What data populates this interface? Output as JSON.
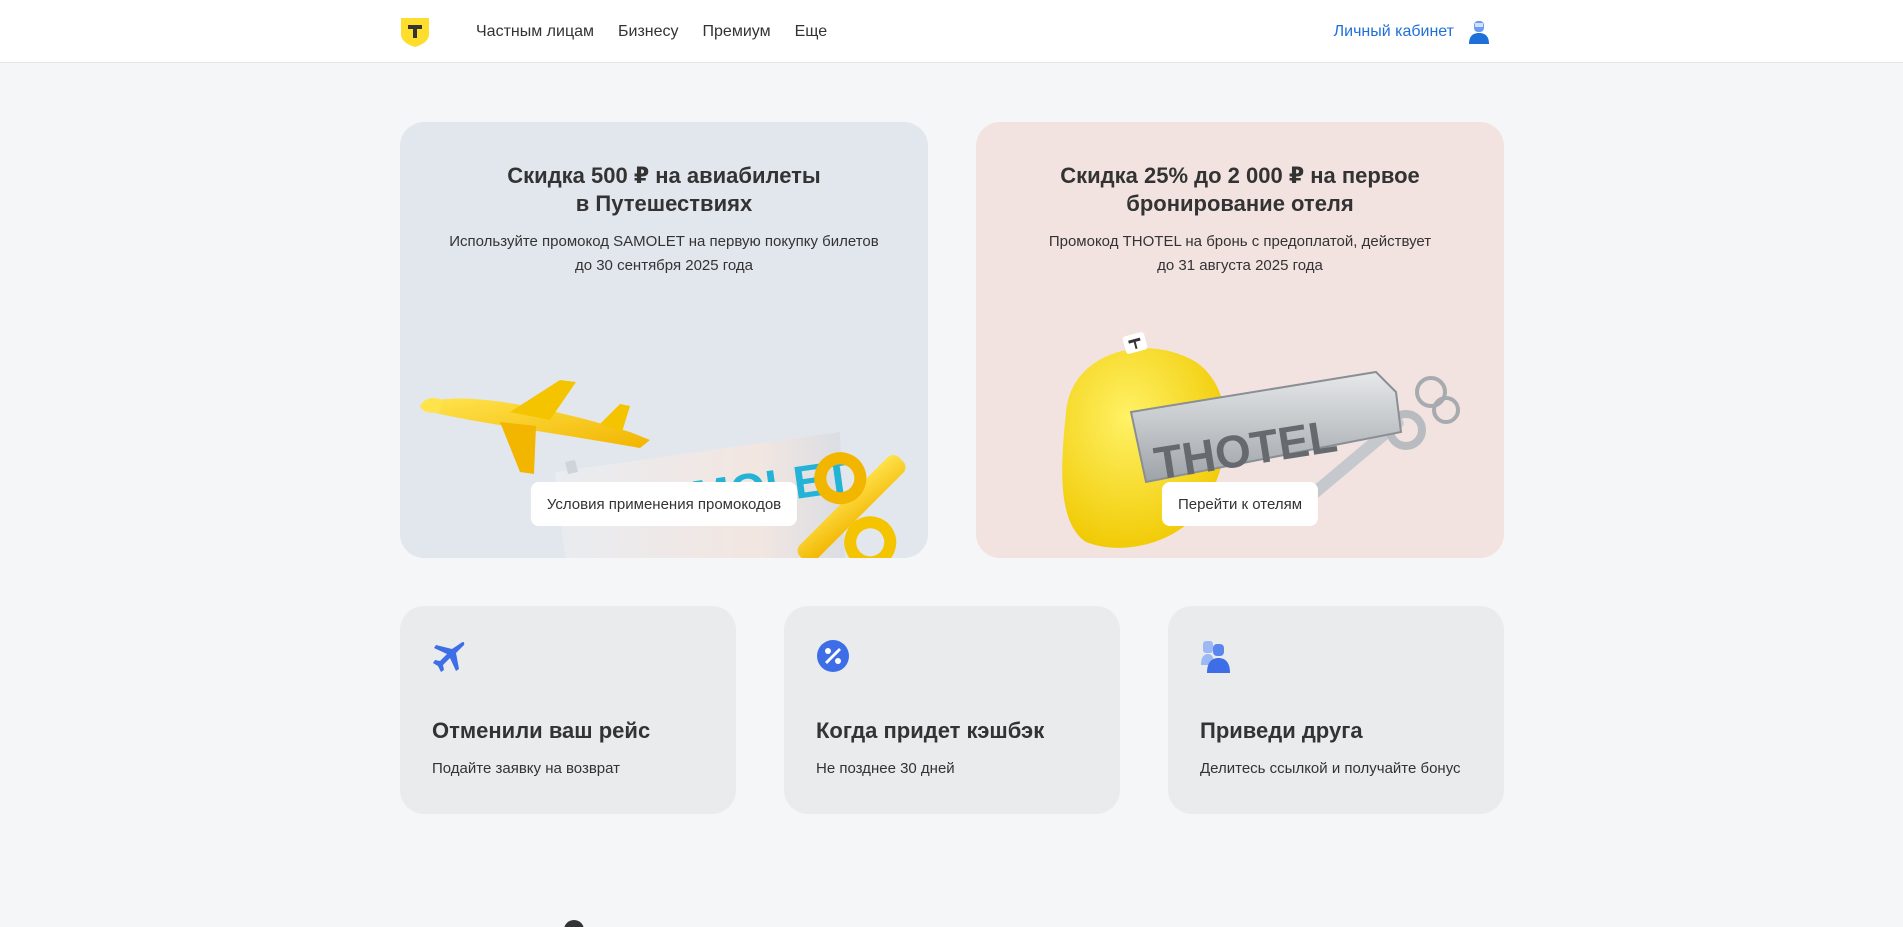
{
  "header": {
    "nav": [
      "Частным лицам",
      "Бизнесу",
      "Премиум",
      "Еще"
    ],
    "cabinet_label": "Личный кабинет"
  },
  "promos": [
    {
      "title": "Скидка 500 ₽ на авиабилеты\nв Путешествиях",
      "text": "Используйте промокод SAMOLET на первую покупку билетов\nдо 30 сентября 2025 года",
      "button": "Условия применения промокодов",
      "art_word": "SAMOLET"
    },
    {
      "title": "Скидка 25% до 2 000 ₽ на первое\nбронирование отеля",
      "text": "Промокод THOTEL на бронь с предоплатой, действует\nдо 31 августа 2025 года",
      "button": "Перейти к отелям",
      "art_word": "THOTEL"
    }
  ],
  "cards": [
    {
      "title": "Отменили ваш рейс",
      "text": "Подайте заявку на возврат",
      "icon": "airplane-icon"
    },
    {
      "title": "Когда придет кэшбэк",
      "text": "Не позднее 30 дней",
      "icon": "percent-icon"
    },
    {
      "title": "Приведи друга",
      "text": "Делитесь ссылкой и получайте бонус",
      "icon": "friends-icon"
    }
  ],
  "colors": {
    "brand_yellow": "#ffdd2d",
    "link_blue": "#1f6fd8",
    "icon_blue": "#3d6ee8"
  }
}
